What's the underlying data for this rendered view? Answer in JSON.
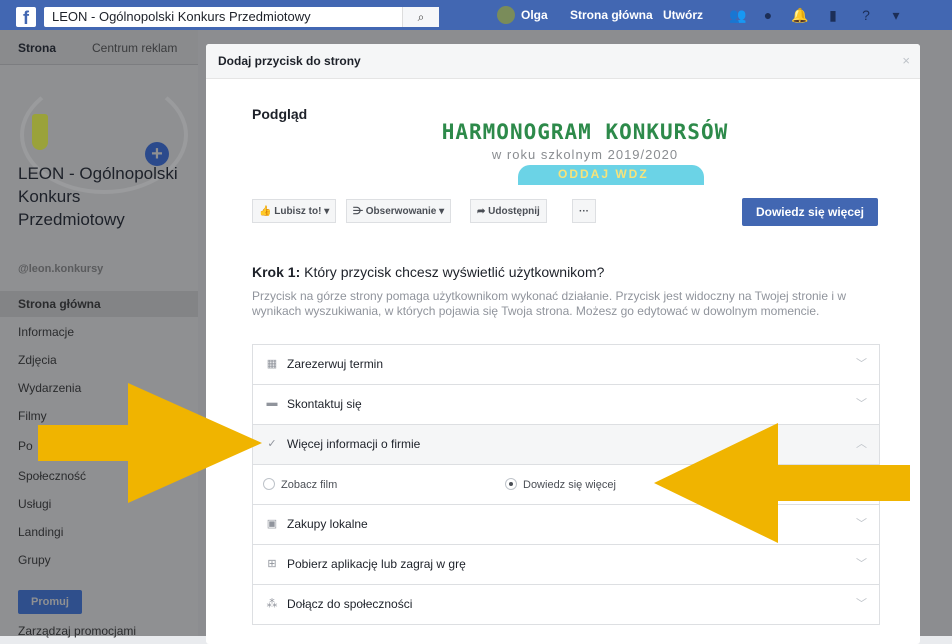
{
  "topbar": {
    "search_text": "LEON - Ogólnopolski Konkurs Przedmiotowy",
    "user_name": "Olga",
    "home_link": "Strona główna",
    "create_link": "Utwórz"
  },
  "sidebar": {
    "tab_page": "Strona",
    "tab_ads": "Centrum reklam",
    "page_name": "LEON - Ogólnopolski Konkurs Przedmiotowy",
    "handle": "@leon.konkursy",
    "nav": [
      "Strona główna",
      "Informacje",
      "Zdjęcia",
      "Wydarzenia",
      "Filmy",
      "Po",
      "Społeczność",
      "Usługi",
      "Landingi",
      "Grupy"
    ],
    "promote_button": "Promuj",
    "manage_promotions": "Zarządzaj promocjami"
  },
  "modal": {
    "title": "Dodaj przycisk do strony",
    "close": "×",
    "preview_label": "Podgląd",
    "banner_title": "HARMONOGRAM KONKURSÓW",
    "banner_subtitle": "w roku szkolnym 2019/2020",
    "banner_pill": "ODDAJ WDZ",
    "actions": {
      "like": "Lubisz to! ▾",
      "follow": "Obserwowanie ▾",
      "share": "Udostępnij",
      "more": "···"
    },
    "learn_more_button": "Dowiedz się więcej",
    "step_label": "Krok 1:",
    "step_question": "Który przycisk chcesz wyświetlić użytkownikom?",
    "step_description": "Przycisk na górze strony pomaga użytkownikom wykonać działanie. Przycisk jest widoczny na Twojej stronie i w wynikach wyszukiwania, w których pojawia się Twoja strona. Możesz go edytować w dowolnym momencie.",
    "options": [
      {
        "label": "Zarezerwuj termin",
        "icon": "calendar-icon"
      },
      {
        "label": "Skontaktuj się",
        "icon": "chat-icon"
      },
      {
        "label": "Więcej informacji o firmie",
        "icon": "check-icon"
      },
      {
        "label": "Zakupy lokalne",
        "icon": "bag-icon"
      },
      {
        "label": "Pobierz aplikację lub zagraj w grę",
        "icon": "download-icon"
      },
      {
        "label": "Dołącz do społeczności",
        "icon": "group-icon"
      }
    ],
    "suboptions": [
      {
        "label": "Zobacz film",
        "selected": false
      },
      {
        "label": "Dowiedz się więcej",
        "selected": true
      }
    ]
  },
  "colors": {
    "facebook_blue": "#4267b2",
    "arrow_yellow": "#f0b400",
    "banner_green": "#2d8a4a",
    "banner_pill": "#6bd3e6"
  }
}
